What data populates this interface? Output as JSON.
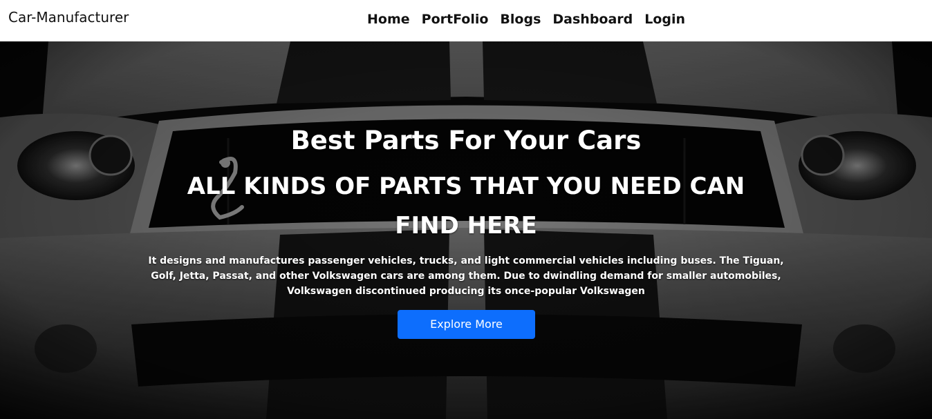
{
  "navbar": {
    "brand": "Car-Manufacturer",
    "links": [
      {
        "label": "Home"
      },
      {
        "label": "PortFolio"
      },
      {
        "label": "Blogs"
      },
      {
        "label": "Dashboard"
      },
      {
        "label": "Login"
      }
    ]
  },
  "hero": {
    "title": "Best Parts For Your Cars",
    "subtitle": "ALL KINDS OF PARTS THAT YOU NEED CAN FIND HERE",
    "description": "It designs and manufactures passenger vehicles, trucks, and light commercial vehicles including buses. The Tiguan, Golf, Jetta, Passat, and other Volkswagen cars are among them. Due to dwindling demand for smaller automobiles, Volkswagen discontinued producing its once-popular Volkswagen",
    "button_label": "Explore More",
    "background_image": "car-front-grille-photo"
  },
  "colors": {
    "navbar_bg": "#ffffff",
    "accent_button": "#0d6efd",
    "hero_text": "#ffffff"
  }
}
